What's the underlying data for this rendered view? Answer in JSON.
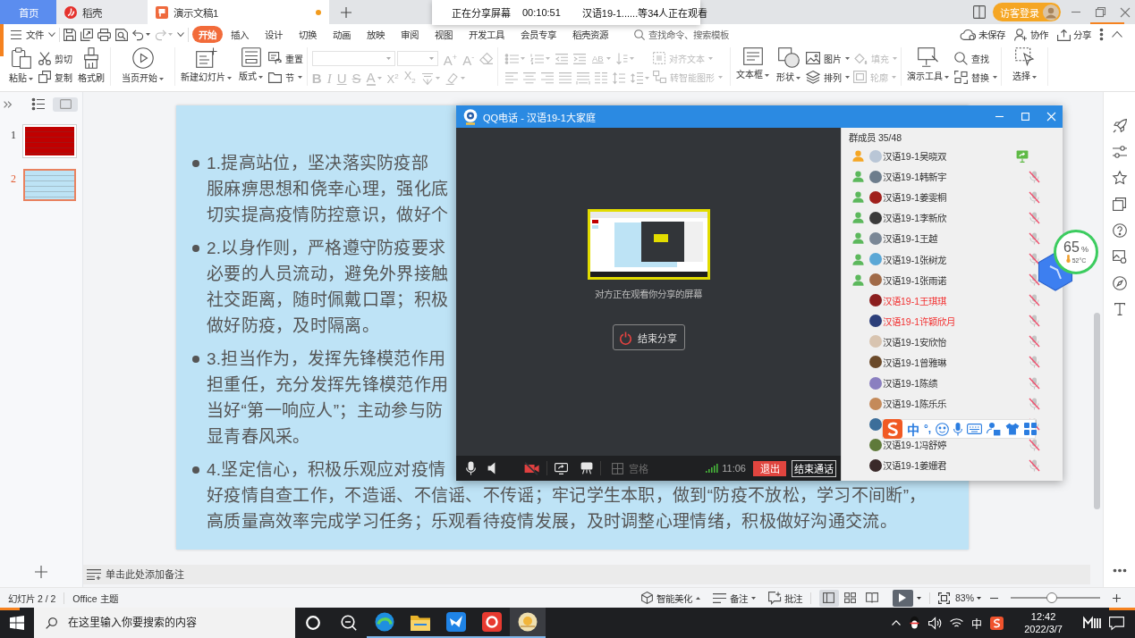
{
  "title_bar": {
    "tabs": [
      {
        "kind": "home",
        "label": "首页",
        "selected": false,
        "modified": false
      },
      {
        "kind": "app",
        "label": "稻壳",
        "selected": false,
        "modified": false
      },
      {
        "kind": "document",
        "label": "演示文稿1",
        "selected": true,
        "modified": true
      }
    ],
    "login": "访客登录"
  },
  "share_banner": {
    "status": "正在分享屏幕",
    "timer": "00:10:51",
    "viewers": "汉语19-1......等34人正在观看"
  },
  "menu_bar": {
    "file": "文件",
    "tabs": [
      {
        "label": "开始",
        "selected": true
      },
      {
        "label": "插入",
        "selected": false
      },
      {
        "label": "设计",
        "selected": false
      },
      {
        "label": "切换",
        "selected": false
      },
      {
        "label": "动画",
        "selected": false
      },
      {
        "label": "放映",
        "selected": false
      },
      {
        "label": "审阅",
        "selected": false
      },
      {
        "label": "视图",
        "selected": false
      },
      {
        "label": "开发工具",
        "selected": false
      },
      {
        "label": "会员专享",
        "selected": false
      },
      {
        "label": "稻壳资源",
        "selected": false
      }
    ],
    "search": {
      "placeholder": "查找命令、搜索模板"
    },
    "actions": [
      "未保存",
      "协作",
      "分享"
    ]
  },
  "ribbon": [
    {
      "kind": "buttons",
      "items": [
        {
          "kind": "large",
          "label": "粘贴",
          "dropdown": true,
          "disabled": false
        },
        {
          "kind": "small",
          "label": "剪切",
          "dropdown": false,
          "disabled": false
        },
        {
          "kind": "small",
          "label": "复制",
          "dropdown": false,
          "disabled": false
        },
        {
          "kind": "large",
          "label": "格式刷",
          "dropdown": false,
          "disabled": false
        }
      ]
    },
    {
      "kind": "buttons",
      "items": [
        {
          "kind": "large",
          "label": "当页开始",
          "dropdown": true,
          "disabled": false
        }
      ]
    },
    {
      "kind": "buttons",
      "items": [
        {
          "kind": "large",
          "label": "新建幻灯片",
          "dropdown": true,
          "disabled": false
        },
        {
          "kind": "large",
          "label": "版式",
          "dropdown": true,
          "disabled": false
        },
        {
          "kind": "small",
          "label": "重置",
          "dropdown": false,
          "disabled": false
        },
        {
          "kind": "small",
          "label": "节",
          "dropdown": true,
          "disabled": false
        }
      ]
    },
    {
      "kind": "font",
      "disabled": true,
      "size_buttons": [
        "A$^{+}$",
        "A$^{-}$"
      ],
      "style_buttons": [
        {
          "label": "B",
          "dropdown": false
        },
        {
          "label": "I",
          "dropdown": false
        },
        {
          "label": "U",
          "dropdown": false
        },
        {
          "label": "S",
          "dropdown": false
        },
        {
          "label": "A",
          "dropdown": true
        },
        {
          "label": "X$^{2}$",
          "dropdown": false
        },
        {
          "label": "X$_{2}$",
          "dropdown": false
        }
      ]
    },
    {
      "kind": "paragraph",
      "disabled": true,
      "text_button": {
        "label": "AB",
        "dropdown": true
      },
      "items": [
        {
          "kind": "small",
          "label": "对齐文本",
          "dropdown": true,
          "disabled": true
        },
        {
          "kind": "small",
          "label": "转智能图形",
          "dropdown": true,
          "disabled": true
        }
      ]
    },
    {
      "kind": "buttons",
      "items": [
        {
          "kind": "large",
          "label": "文本框",
          "dropdown": true,
          "disabled": false
        },
        {
          "kind": "large",
          "label": "形状",
          "dropdown": true,
          "disabled": false
        },
        {
          "kind": "small",
          "label": "图片",
          "dropdown": true,
          "disabled": false
        },
        {
          "kind": "small",
          "label": "排列",
          "dropdown": true,
          "disabled": false
        },
        {
          "kind": "small",
          "label": "填充",
          "dropdown": true,
          "disabled": true
        },
        {
          "kind": "small",
          "label": "轮廓",
          "dropdown": true,
          "disabled": true
        }
      ]
    },
    {
      "kind": "buttons",
      "items": [
        {
          "kind": "large",
          "label": "演示工具",
          "dropdown": true,
          "disabled": false
        },
        {
          "kind": "small",
          "label": "查找",
          "dropdown": false,
          "disabled": false
        },
        {
          "kind": "small",
          "label": "替换",
          "dropdown": true,
          "disabled": false
        }
      ]
    },
    {
      "kind": "buttons",
      "items": [
        {
          "kind": "large",
          "label": "选择",
          "dropdown": true,
          "disabled": false
        }
      ]
    }
  ],
  "slide_panel": {
    "views": [
      {
        "selected": false
      },
      {
        "selected": true
      }
    ],
    "thumbnails": [
      {
        "number": "1",
        "selected": false,
        "color": "#c00000"
      },
      {
        "number": "2",
        "selected": true,
        "color": "#bde3f5"
      }
    ]
  },
  "slide": {
    "bullets": [
      {
        "lines": [
          "1.提高站位，坚决落实防疫部",
          "服麻痹思想和侥幸心理，强化底",
          "切实提高疫情防控意识，做好个"
        ]
      },
      {
        "lines": [
          "2.以身作则，严格遵守防疫要求",
          "必要的人员流动，避免外界接触",
          "社交距离，随时佩戴口罩；积极",
          "做好防疫，及时隔离。"
        ]
      },
      {
        "lines": [
          "3.担当作为，发挥先锋模范作用",
          "担重任，充分发挥先锋模范作用",
          "当好“第一响应人”；主动参与防",
          "显青春风采。"
        ]
      },
      {
        "lines": [
          "4.坚定信心，积极乐观应对疫情",
          "好疫情自查工作，不造谣、不信谣、不传谣；牢记学生本职，做到“防疫不放松，学习不间断”，",
          "高质量高效率完成学习任务；乐观看待疫情发展，及时调整心理情绪，积极做好沟通交流。"
        ]
      }
    ]
  },
  "notes": {
    "placeholder": "单击此处添加备注"
  },
  "status_bar": {
    "slide": "幻灯片 2 / 2",
    "theme": "Office 主题",
    "beautify": "智能美化",
    "notes": "备注",
    "comments": "批注",
    "views": [
      {
        "selected": true
      },
      {
        "selected": false
      },
      {
        "selected": false
      }
    ],
    "zoom": "83%",
    "zoom_slider": {
      "level": 0.46
    }
  },
  "taskbar": {
    "search": {
      "placeholder": "在这里输入你要搜索的内容"
    },
    "apps": [
      {
        "running": true,
        "selected": false
      },
      {
        "running": true,
        "selected": false
      },
      {
        "running": true,
        "selected": false
      },
      {
        "running": true,
        "selected": false
      },
      {
        "running": true,
        "selected": true
      }
    ],
    "ime": "中",
    "time": "12:42",
    "date": "2022/3/7"
  },
  "qq_call": {
    "title": "QQ电话 - 汉语19-1大家庭",
    "caption": "对方正在观看你分享的屏幕",
    "stop_share": "结束分享",
    "toolbar": {
      "camera_on": false,
      "grid": {
        "label": "宫格",
        "disabled": true
      },
      "duration": "11:06",
      "exit": "退出",
      "end_call": "结束通话"
    },
    "members_header": "群成员 35/48",
    "members": [
      {
        "kind": "sharing",
        "color": "#f5a623",
        "name": "汉语19-1吴晓双",
        "highlighted": false
      },
      {
        "kind": "muted",
        "color": "#5cb85c",
        "name": "汉语19-1韩新宇",
        "highlighted": false
      },
      {
        "kind": "muted",
        "color": "#5cb85c",
        "name": "汉语19-1姜雯桐",
        "highlighted": false
      },
      {
        "kind": "muted",
        "color": "#5cb85c",
        "name": "汉语19-1李新欣",
        "highlighted": false
      },
      {
        "kind": "muted",
        "color": "#5cb85c",
        "name": "汉语19-1王越",
        "highlighted": false
      },
      {
        "kind": "muted",
        "color": "#5cb85c",
        "name": "汉语19-1张树龙",
        "highlighted": false
      },
      {
        "kind": "muted",
        "color": "#5cb85c",
        "name": "汉语19-1张雨诺",
        "highlighted": false
      },
      {
        "kind": "muted",
        "name": "汉语19-1王琪琪",
        "highlighted": true
      },
      {
        "kind": "muted",
        "name": "汉语19-1许颖欣月",
        "highlighted": true
      },
      {
        "kind": "muted",
        "name": "汉语19-1安欣怡",
        "highlighted": false
      },
      {
        "kind": "muted",
        "name": "汉语19-1曾雅琳",
        "highlighted": false
      },
      {
        "kind": "muted",
        "name": "汉语19-1陈绩",
        "highlighted": false
      },
      {
        "kind": "muted",
        "name": "汉语19-1陈乐乐",
        "highlighted": false
      },
      {
        "kind": "muted"
      },
      {
        "kind": "muted",
        "name": "汉语19-1冯舒婷",
        "highlighted": false
      },
      {
        "kind": "muted",
        "name": "汉语19-1姜姗君",
        "highlighted": false
      }
    ]
  },
  "monitor_widget": {
    "load": "65",
    "unit": "%",
    "temperature": "52°C"
  },
  "ime_toolbar": {
    "mode": "中",
    "punctuation": "°,"
  }
}
